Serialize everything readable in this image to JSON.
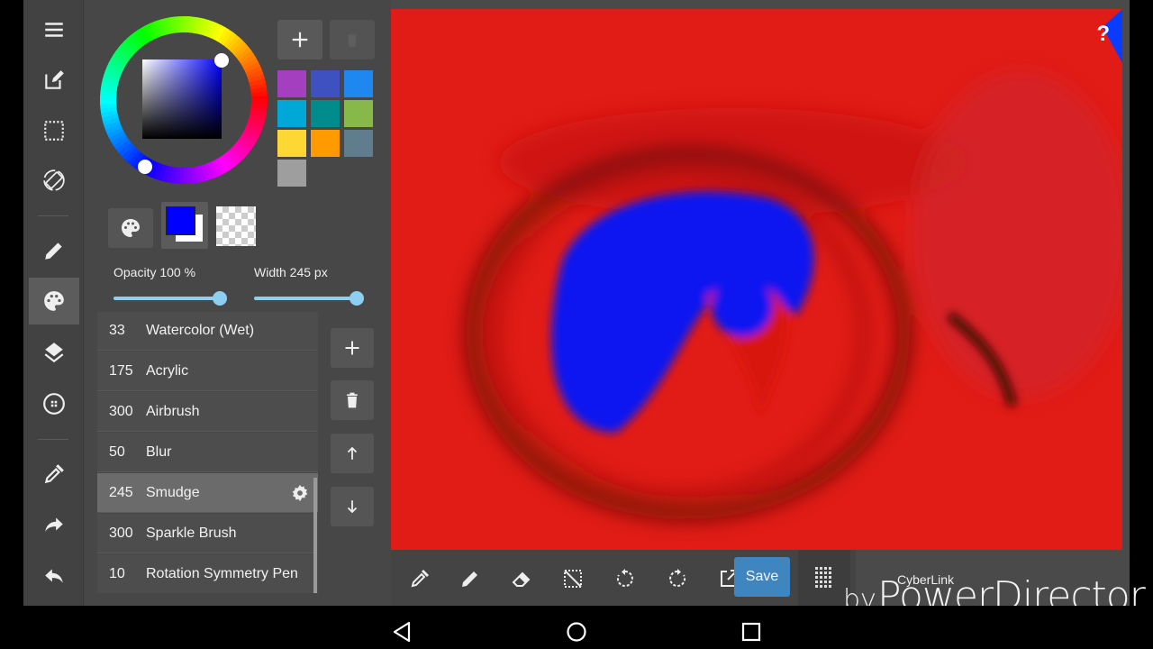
{
  "app": {
    "name": "drawing-app-brush-panel"
  },
  "toolbar": {
    "items": [
      {
        "id": "menu",
        "icon": "menu-icon"
      },
      {
        "id": "edit",
        "icon": "edit-icon"
      },
      {
        "id": "selection",
        "icon": "selection-icon"
      },
      {
        "id": "rotate",
        "icon": "rotate-screen-icon"
      },
      {
        "id": "brush",
        "icon": "pencil-icon"
      },
      {
        "id": "color",
        "icon": "palette-icon",
        "active": true
      },
      {
        "id": "layers",
        "icon": "layers-icon"
      },
      {
        "id": "material",
        "icon": "material-icon"
      },
      {
        "id": "eyedropper",
        "icon": "eyedropper-icon"
      },
      {
        "id": "redo",
        "icon": "redo-icon"
      },
      {
        "id": "undo",
        "icon": "undo-icon"
      }
    ]
  },
  "color_panel": {
    "current_color": "#0000ff",
    "secondary_color": "#ffffff",
    "add_label": "+",
    "palette": [
      "#a43fc0",
      "#3f51c0",
      "#1e88f0",
      "#00a8d8",
      "#008c8c",
      "#86b84a",
      "#fdd835",
      "#ff9a00",
      "#5f7d8c",
      "#9e9e9e"
    ]
  },
  "sliders": {
    "opacity": {
      "label": "Opacity 100 %",
      "value": 100,
      "max": 100
    },
    "width": {
      "label": "Width 245 px",
      "value": 245,
      "max": 250
    }
  },
  "brushes": [
    {
      "size": "33",
      "name": "Watercolor (Wet)"
    },
    {
      "size": "175",
      "name": "Acrylic"
    },
    {
      "size": "300",
      "name": "Airbrush"
    },
    {
      "size": "50",
      "name": "Blur"
    },
    {
      "size": "245",
      "name": "Smudge",
      "selected": true
    },
    {
      "size": "300",
      "name": "Sparkle Brush"
    },
    {
      "size": "10",
      "name": "Rotation Symmetry Pen"
    }
  ],
  "bottom_bar": {
    "save_label": "Save"
  },
  "canvas": {
    "help_label": "?"
  },
  "watermark": {
    "by": "by",
    "brand": "CyberLink",
    "product": "PowerDirector"
  },
  "navbar": {
    "back": "back-icon",
    "home": "home-icon",
    "recent": "recent-apps-icon"
  }
}
